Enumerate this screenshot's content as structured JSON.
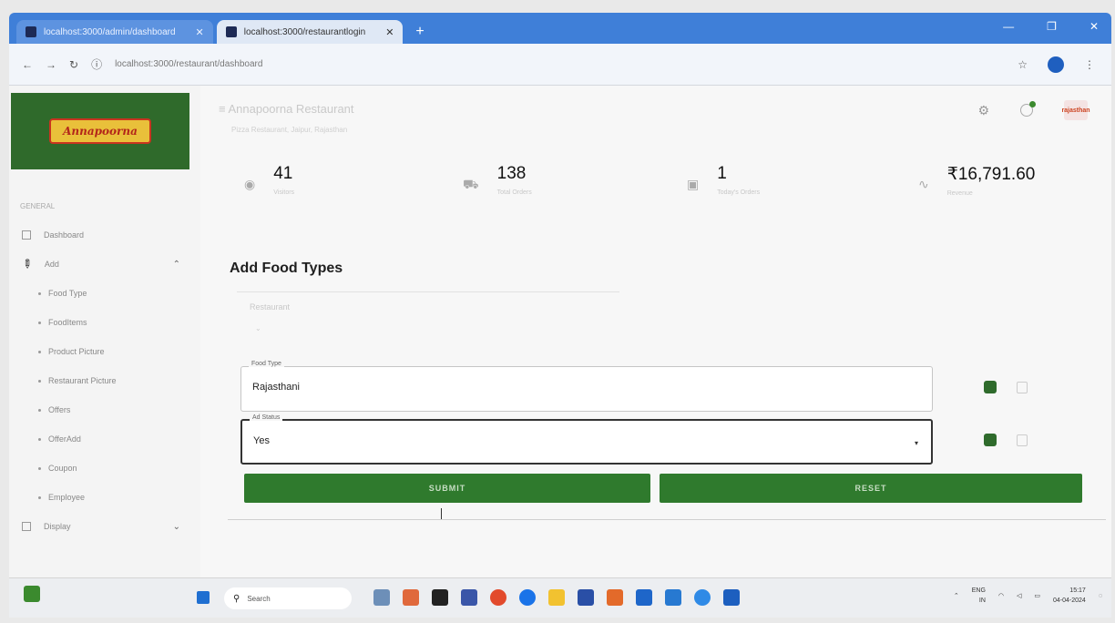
{
  "browser": {
    "tabs": [
      {
        "label": "localhost:3000/admin/dashboard",
        "active": false
      },
      {
        "label": "localhost:3000/restaurantlogin",
        "active": true
      }
    ],
    "url": "localhost:3000/restaurant/dashboard"
  },
  "header": {
    "title": "Annapoorna Restaurant",
    "subtitle": "Pizza Restaurant, Jaipur, Rajasthan"
  },
  "logo": {
    "text": "Annapoorna"
  },
  "avatar_text": "rajasthan",
  "sidebar": {
    "section_label": "GENERAL",
    "items": [
      {
        "label": "Dashboard",
        "icon": "dashboard-icon",
        "level": 0
      },
      {
        "label": "Add",
        "icon": "pencil-icon",
        "level": 0,
        "expanded": true
      },
      {
        "label": "Food Type",
        "level": 1
      },
      {
        "label": "FoodItems",
        "level": 1
      },
      {
        "label": "Product Picture",
        "level": 1
      },
      {
        "label": "Restaurant Picture",
        "level": 1
      },
      {
        "label": "Offers",
        "level": 1
      },
      {
        "label": "OfferAdd",
        "level": 1
      },
      {
        "label": "Coupon",
        "level": 1
      },
      {
        "label": "Employee",
        "level": 1
      },
      {
        "label": "Display",
        "icon": "display-icon",
        "level": 0,
        "expanded": false
      }
    ]
  },
  "stats": [
    {
      "value": "41",
      "label": "Visitors",
      "icon": "eye-icon"
    },
    {
      "value": "138",
      "label": "Total Orders",
      "icon": "cart-icon"
    },
    {
      "value": "1",
      "label": "Today's Orders",
      "icon": "calendar-icon"
    },
    {
      "value": "₹16,791.60",
      "label": "Revenue",
      "icon": "trend-icon"
    }
  ],
  "form": {
    "title": "Add Food Types",
    "faint_label": "Restaurant",
    "fields": [
      {
        "legend": "Food Type",
        "value": "Rajasthani"
      },
      {
        "legend": "Ad Status",
        "value": "Yes"
      }
    ],
    "submit_label": "SUBMIT",
    "reset_label": "RESET"
  },
  "taskbar": {
    "search_placeholder": "Search",
    "lang": "ENG",
    "region": "IN",
    "time": "15:17",
    "date": "04-04-2024"
  },
  "colors": {
    "primary_green": "#2f7a2d",
    "browser_blue": "#3f7fd8"
  }
}
